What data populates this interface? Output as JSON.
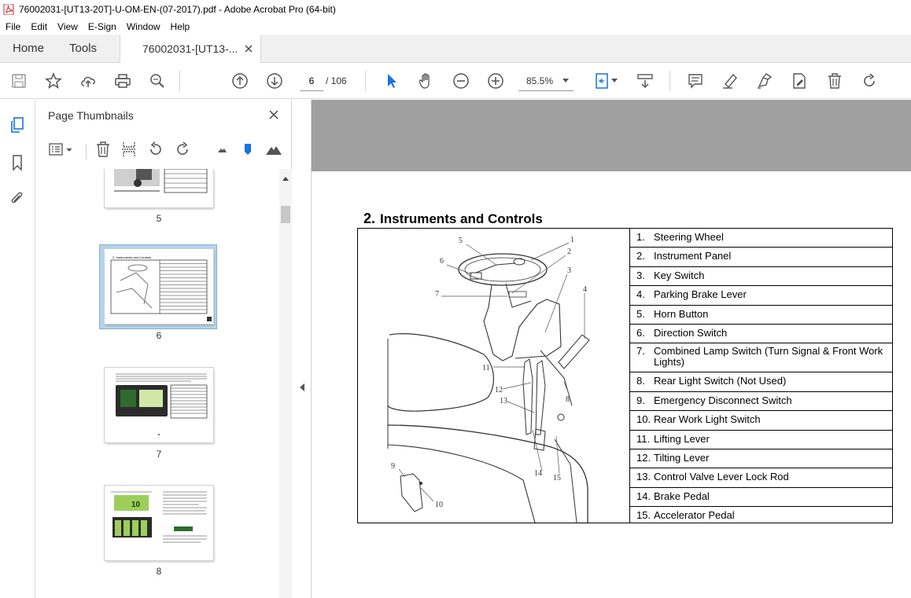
{
  "window": {
    "title": "76002031-[UT13-20T]-U-OM-EN-(07-2017).pdf - Adobe Acrobat Pro (64-bit)"
  },
  "menu": [
    "File",
    "Edit",
    "View",
    "E-Sign",
    "Window",
    "Help"
  ],
  "tabs": {
    "home": "Home",
    "tools": "Tools",
    "document": "76002031-[UT13-..."
  },
  "toolbar": {
    "current_page": "6",
    "total_pages": "/ 106",
    "zoom": "85.5%"
  },
  "thumbnail_panel": {
    "title": "Page Thumbnails",
    "pages": [
      {
        "number": "5",
        "selected": false
      },
      {
        "number": "6",
        "selected": true
      },
      {
        "number": "7",
        "selected": false
      },
      {
        "number": "8",
        "selected": false
      }
    ],
    "thumb8_text": "10"
  },
  "document": {
    "heading_number": "2.",
    "heading_text": "Instruments and Controls",
    "callouts": [
      "1",
      "2",
      "3",
      "4",
      "5",
      "6",
      "7",
      "8",
      "9",
      "10",
      "11",
      "12",
      "13",
      "14",
      "15"
    ],
    "parts": [
      {
        "num": "1.",
        "label": "Steering Wheel"
      },
      {
        "num": "2.",
        "label": "Instrument Panel"
      },
      {
        "num": "3.",
        "label": "Key Switch"
      },
      {
        "num": "4.",
        "label": "Parking Brake Lever"
      },
      {
        "num": "5.",
        "label": "Horn Button"
      },
      {
        "num": "6.",
        "label": "Direction Switch"
      },
      {
        "num": "7.",
        "label": "Combined Lamp Switch (Turn Signal & Front Work Lights)"
      },
      {
        "num": "8.",
        "label": "Rear Light Switch (Not Used)"
      },
      {
        "num": "9.",
        "label": "Emergency Disconnect Switch"
      },
      {
        "num": "10.",
        "label": "Rear Work Light Switch"
      },
      {
        "num": "11.",
        "label": "Lifting Lever"
      },
      {
        "num": "12.",
        "label": "Tilting Lever"
      },
      {
        "num": "13.",
        "label": "Control Valve Lever Lock Rod"
      },
      {
        "num": "14.",
        "label": "Brake Pedal"
      },
      {
        "num": "15.",
        "label": "Accelerator Pedal"
      }
    ],
    "page_number": "6"
  },
  "colors": {
    "acrobat_red": "#d1232a",
    "selection_blue": "#b5d4e8",
    "cursor_blue": "#1473e6",
    "doc_gray": "#a0a0a0"
  }
}
